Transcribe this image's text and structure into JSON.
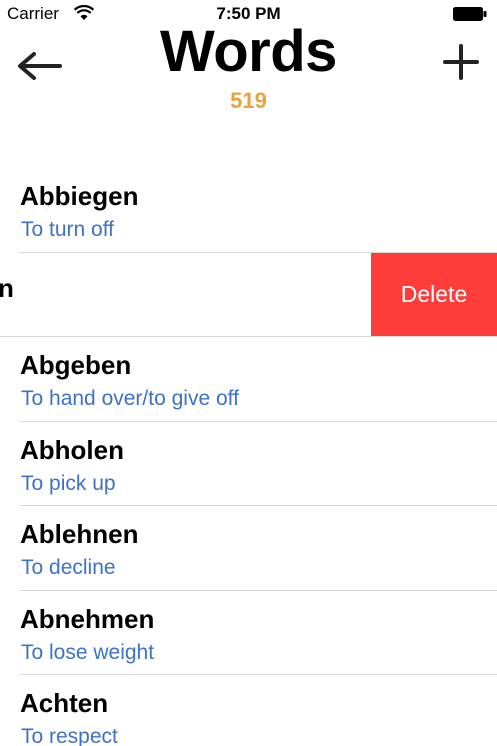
{
  "status_bar": {
    "carrier": "Carrier",
    "time": "7:50 PM"
  },
  "nav": {
    "title": "Words",
    "count": "519",
    "back_icon": "arrow-left-icon",
    "add_icon": "plus-icon"
  },
  "colors": {
    "accent_count": "#E8A33C",
    "translation": "#3E72C4",
    "delete": "#FC3D39",
    "separator": "#d8d8d8"
  },
  "words": [
    {
      "word": "Abbiegen",
      "translation": "To turn off"
    },
    {
      "word": "n",
      "translation": "",
      "swiped": true,
      "delete_label": "Delete"
    },
    {
      "word": "Abgeben",
      "translation": "To hand over/to give off"
    },
    {
      "word": "Abholen",
      "translation": "To pick up"
    },
    {
      "word": "Ablehnen",
      "translation": "To decline"
    },
    {
      "word": "Abnehmen",
      "translation": "To lose weight"
    },
    {
      "word": "Achten",
      "translation": "To respect"
    }
  ]
}
